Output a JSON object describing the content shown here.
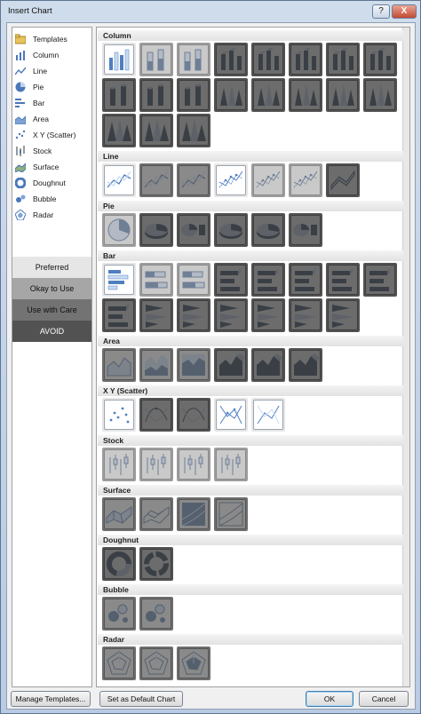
{
  "window": {
    "title": "Insert Chart",
    "help_label": "?",
    "close_label": "X"
  },
  "categories": [
    {
      "label": "Templates",
      "icon": "folder-icon"
    },
    {
      "label": "Column",
      "icon": "column-chart-icon"
    },
    {
      "label": "Line",
      "icon": "line-chart-icon"
    },
    {
      "label": "Pie",
      "icon": "pie-chart-icon"
    },
    {
      "label": "Bar",
      "icon": "bar-chart-icon"
    },
    {
      "label": "Area",
      "icon": "area-chart-icon"
    },
    {
      "label": "X Y (Scatter)",
      "icon": "scatter-chart-icon"
    },
    {
      "label": "Stock",
      "icon": "stock-chart-icon"
    },
    {
      "label": "Surface",
      "icon": "surface-chart-icon"
    },
    {
      "label": "Doughnut",
      "icon": "doughnut-chart-icon"
    },
    {
      "label": "Bubble",
      "icon": "bubble-chart-icon"
    },
    {
      "label": "Radar",
      "icon": "radar-chart-icon"
    }
  ],
  "legend": [
    {
      "label": "Preferred",
      "level": "pref",
      "color": "#e6e6e6"
    },
    {
      "label": "Okay to Use",
      "level": "okay",
      "color": "#a6a6a6"
    },
    {
      "label": "Use with Care",
      "level": "care",
      "color": "#737373"
    },
    {
      "label": "AVOID",
      "level": "avoid",
      "color": "#525252"
    }
  ],
  "sections": [
    {
      "title": "Column",
      "rows": [
        [
          "pref:column",
          "okay:column-stacked",
          "okay:column-100",
          "avoid:column-3d",
          "avoid:column-3d",
          "avoid:column-3d",
          "avoid:column-3d",
          "avoid:column-3d"
        ],
        [
          "avoid:cylinder",
          "avoid:cylinder",
          "avoid:cylinder",
          "avoid:cone",
          "avoid:cone",
          "avoid:cone",
          "avoid:cone",
          "avoid:cone"
        ],
        [
          "avoid:pyramid",
          "avoid:pyramid",
          "avoid:pyramid"
        ]
      ]
    },
    {
      "title": "Line",
      "rows": [
        [
          "pref:line",
          "care:line",
          "care:line",
          "pref:line-markers",
          "okay:line-markers",
          "okay:line-markers",
          "avoid:line-3d"
        ]
      ]
    },
    {
      "title": "Pie",
      "rows": [
        [
          "okay:pie",
          "avoid:pie-3d",
          "avoid:pie-of-pie",
          "avoid:pie-exploded",
          "avoid:pie-3d-exploded",
          "avoid:bar-of-pie"
        ]
      ]
    },
    {
      "title": "Bar",
      "rows": [
        [
          "pref:bar",
          "okay:bar-stacked",
          "okay:bar-100",
          "avoid:bar-3d",
          "avoid:bar-3d",
          "avoid:bar-3d",
          "avoid:bar-3d",
          "avoid:bar-3d"
        ],
        [
          "avoid:bar-cyl",
          "avoid:bar-cone",
          "avoid:bar-cone",
          "avoid:bar-cone",
          "avoid:bar-cone",
          "avoid:bar-cone",
          "avoid:bar-cone"
        ]
      ]
    },
    {
      "title": "Area",
      "rows": [
        [
          "care:area",
          "care:area-stacked",
          "care:area-100",
          "avoid:area-3d",
          "avoid:area-3d",
          "avoid:area-3d"
        ]
      ]
    },
    {
      "title": "X Y (Scatter)",
      "rows": [
        [
          "pref:scatter",
          "avoid:scatter-smooth",
          "avoid:scatter-smooth-lines",
          "pref:scatter-lines-markers",
          "pref:scatter-lines"
        ]
      ]
    },
    {
      "title": "Stock",
      "rows": [
        [
          "okay:stock-hlc",
          "okay:stock-ohlc",
          "okay:stock-vhlc",
          "okay:stock-vohlc"
        ]
      ]
    },
    {
      "title": "Surface",
      "rows": [
        [
          "care:surface-3d",
          "care:surface-wire",
          "care:contour",
          "care:contour-wire"
        ]
      ]
    },
    {
      "title": "Doughnut",
      "rows": [
        [
          "avoid:doughnut",
          "avoid:doughnut-exploded"
        ]
      ]
    },
    {
      "title": "Bubble",
      "rows": [
        [
          "care:bubble",
          "care:bubble-3d"
        ]
      ]
    },
    {
      "title": "Radar",
      "rows": [
        [
          "care:radar",
          "care:radar-markers",
          "care:radar-filled"
        ]
      ]
    }
  ],
  "footer": {
    "manage_templates": "Manage Templates...",
    "set_default": "Set as Default Chart",
    "ok": "OK",
    "cancel": "Cancel"
  }
}
